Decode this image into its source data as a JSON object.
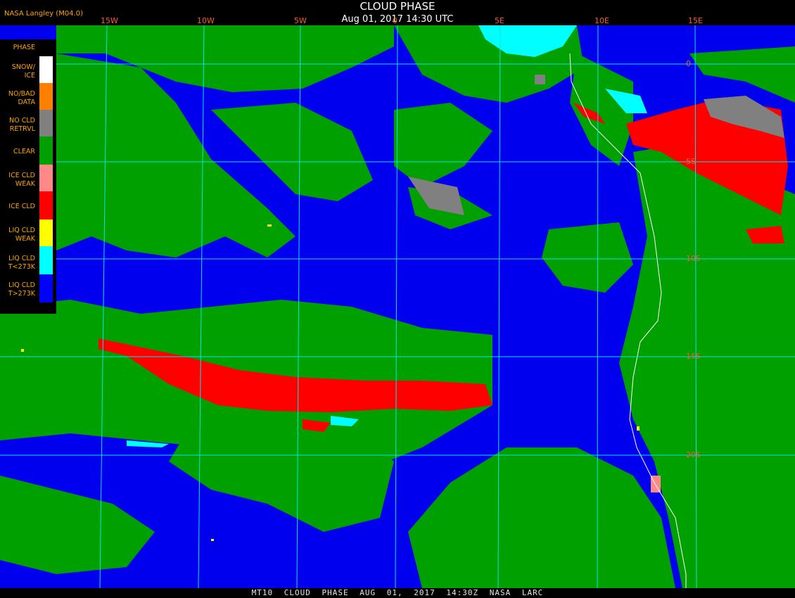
{
  "header": {
    "title": "CLOUD PHASE",
    "subtitle": "Aug 01, 2017 14:30 UTC",
    "provider": "NASA Langley (M04.0)"
  },
  "longitudes": [
    "15W",
    "10W",
    "5W",
    "0",
    "5E",
    "10E",
    "15E"
  ],
  "latitudes": [
    "0",
    "5S",
    "10S",
    "15S",
    "20S"
  ],
  "legend": {
    "title": "PHASE",
    "items": [
      {
        "label": "SNOW/\nICE",
        "color": "#ffffff"
      },
      {
        "label": "NO/BAD\nDATA",
        "color": "#ff8000"
      },
      {
        "label": "NO CLD\nRETRVL",
        "color": "#808080"
      },
      {
        "label": "CLEAR",
        "color": "#00a000"
      },
      {
        "label": "ICE CLD\nWEAK",
        "color": "#ff8888"
      },
      {
        "label": "ICE CLD",
        "color": "#ff0000"
      },
      {
        "label": "LIQ CLD\nWEAK",
        "color": "#ffff00"
      },
      {
        "label": "LIQ CLD\nT<273K",
        "color": "#00ffff"
      },
      {
        "label": "LIQ CLD\nT>273K",
        "color": "#0000ff"
      }
    ]
  },
  "footer": "MT10 CLOUD PHASE AUG 01, 2017 14:30Z NASA LARC",
  "colors": {
    "ocean_liquid_cloud": "#0000ee",
    "clear": "#00a000",
    "ice": "#ff0000",
    "grid": "#00e5e5",
    "label": "#ff5a2a"
  }
}
